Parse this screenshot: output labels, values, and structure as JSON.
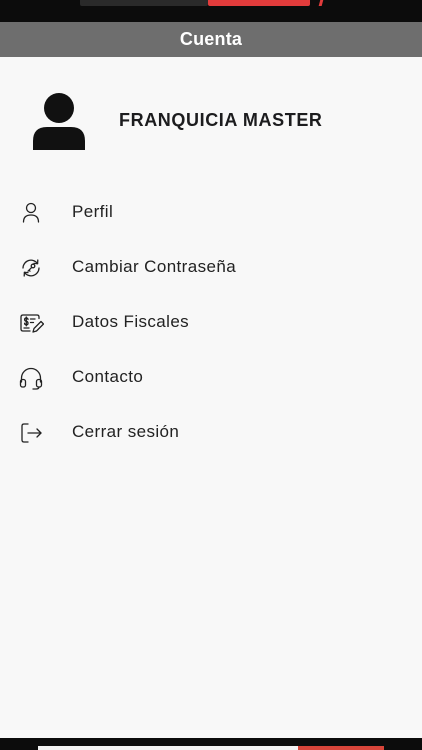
{
  "header": {
    "title": "Cuenta"
  },
  "profile": {
    "name": "FRANQUICIA MASTER",
    "avatar_icon": "person-silhouette-icon"
  },
  "menu": {
    "items": [
      {
        "label": "Perfil",
        "icon": "user-icon"
      },
      {
        "label": "Cambiar Contraseña",
        "icon": "refresh-key-icon"
      },
      {
        "label": "Datos Fiscales",
        "icon": "invoice-edit-icon"
      },
      {
        "label": "Contacto",
        "icon": "headphones-icon"
      },
      {
        "label": "Cerrar sesión",
        "icon": "logout-icon"
      }
    ]
  },
  "colors": {
    "header_bg": "#6e6e6e",
    "background": "#f8f8f8",
    "brand_accent": "#e23c3c"
  }
}
